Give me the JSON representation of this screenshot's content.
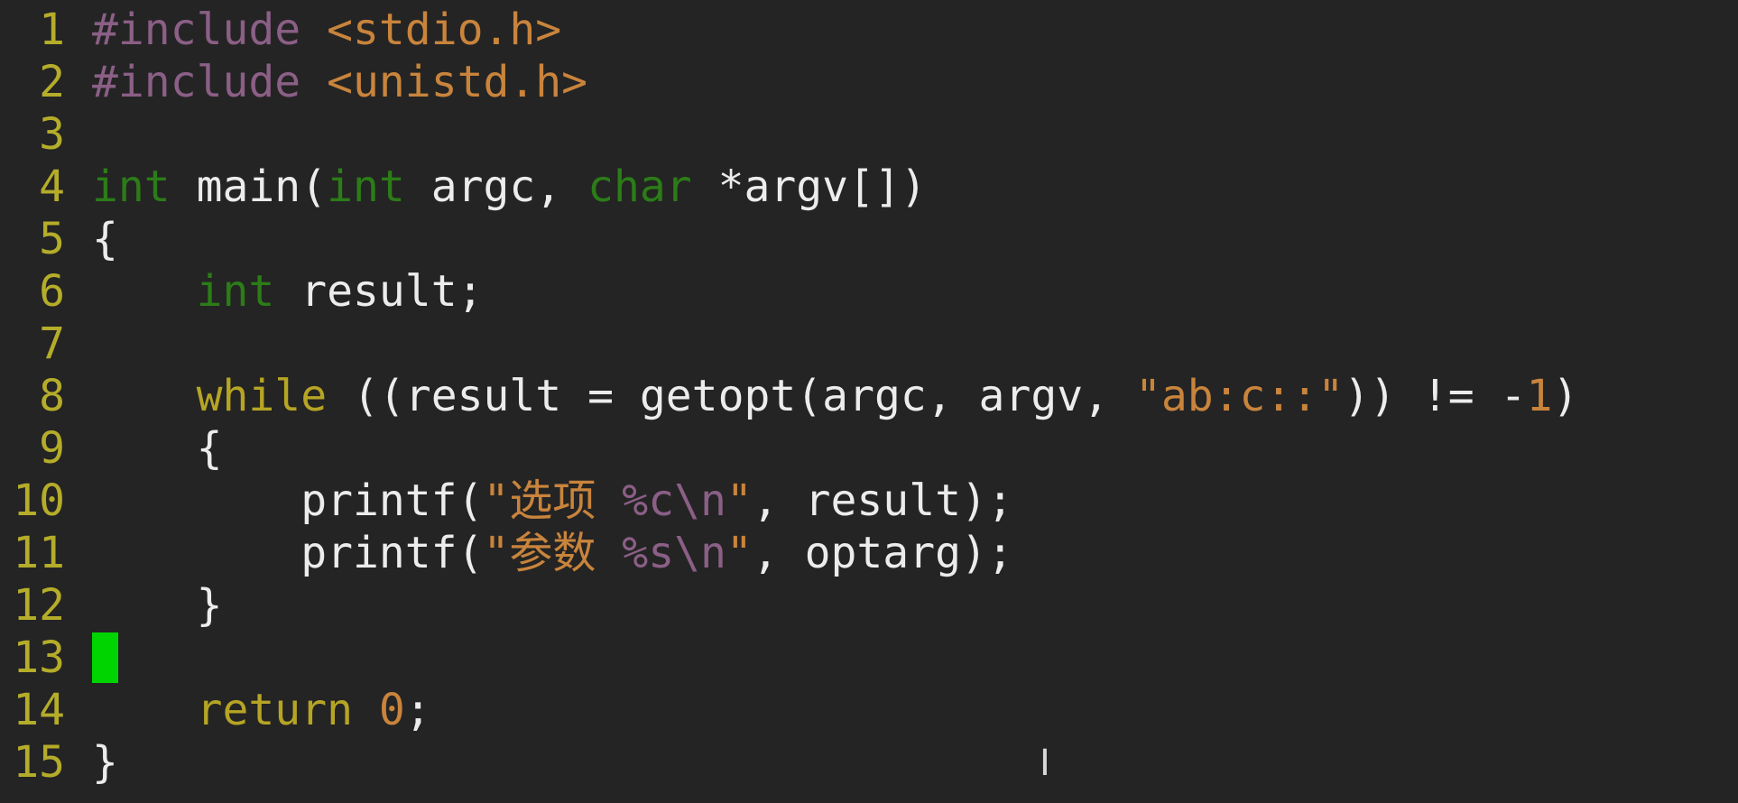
{
  "editor": {
    "colors": {
      "background": "#242424",
      "line_number": "#b5ad2a",
      "preprocessor": "#8b5f86",
      "type_keyword": "#2c7c18",
      "control_keyword": "#b6a525",
      "string": "#c9843c",
      "cursor": "#00d400"
    },
    "lines": [
      {
        "num": "1",
        "tokens": [
          "#include",
          " ",
          "<stdio.h>"
        ]
      },
      {
        "num": "2",
        "tokens": [
          "#include",
          " ",
          "<unistd.h>"
        ]
      },
      {
        "num": "3",
        "tokens": []
      },
      {
        "num": "4",
        "tokens": [
          "int",
          " main(",
          "int",
          " argc, ",
          "char",
          " *argv[])"
        ]
      },
      {
        "num": "5",
        "tokens": [
          "{"
        ]
      },
      {
        "num": "6",
        "tokens": [
          "    ",
          "int",
          " result;"
        ]
      },
      {
        "num": "7",
        "tokens": []
      },
      {
        "num": "8",
        "tokens": [
          "    ",
          "while",
          " ((result = getopt(argc, argv, ",
          "\"ab:c::\"",
          ")) != -",
          "1",
          ")"
        ]
      },
      {
        "num": "9",
        "tokens": [
          "    {"
        ]
      },
      {
        "num": "10",
        "tokens": [
          "        printf(",
          "\"选项 ",
          "%c\\n",
          "\"",
          ", result);"
        ]
      },
      {
        "num": "11",
        "tokens": [
          "        printf(",
          "\"参数 ",
          "%s\\n",
          "\"",
          ", optarg);"
        ]
      },
      {
        "num": "12",
        "tokens": [
          "    }"
        ]
      },
      {
        "num": "13",
        "tokens": []
      },
      {
        "num": "14",
        "tokens": [
          "    ",
          "return",
          " ",
          "0",
          ";"
        ]
      },
      {
        "num": "15",
        "tokens": [
          "}"
        ]
      }
    ],
    "mouse_pointer": "text-ibeam-icon"
  }
}
